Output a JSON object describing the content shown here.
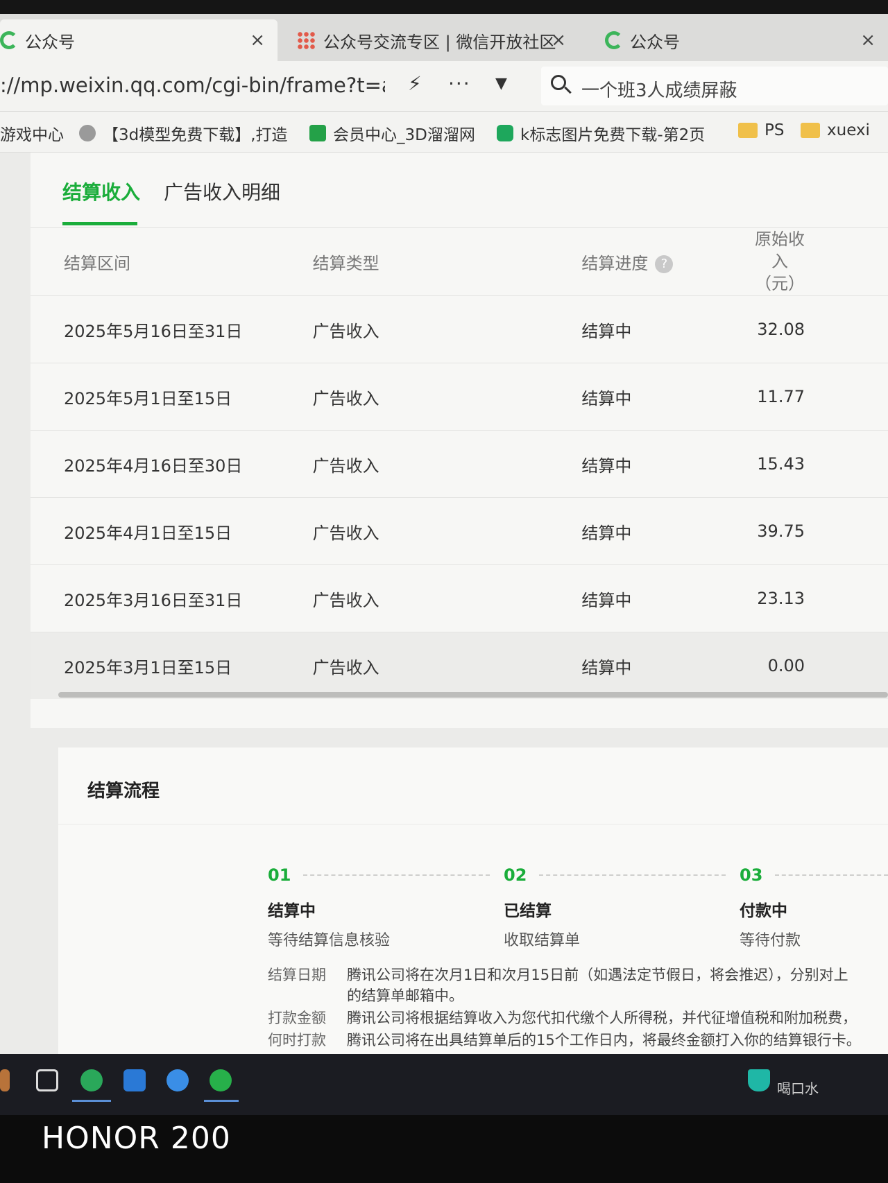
{
  "browser": {
    "tabs": [
      {
        "title": "公众号",
        "close": "×"
      },
      {
        "title": "公众号交流专区 | 微信开放社区",
        "close": "×"
      },
      {
        "title": "公众号",
        "close": "×"
      }
    ],
    "url": "://mp.weixin.qq.com/cgi-bin/frame?t=ad_system",
    "search_query": "一个班3人成绩屏蔽",
    "bookmarks": [
      "游戏中心",
      "【3d模型免费下载】,打造",
      "会员中心_3D溜溜网",
      "k标志图片免费下载-第2页",
      "PS",
      "xuexi"
    ]
  },
  "page": {
    "tabs": [
      {
        "label": "结算收入",
        "active": true
      },
      {
        "label": "广告收入明细",
        "active": false
      }
    ],
    "table": {
      "headers": [
        "结算区间",
        "结算类型",
        "结算进度",
        "原始收入",
        "（元）"
      ],
      "rows": [
        {
          "period": "2025年5月16日至31日",
          "type": "广告收入",
          "status": "结算中",
          "amount": "32.08"
        },
        {
          "period": "2025年5月1日至15日",
          "type": "广告收入",
          "status": "结算中",
          "amount": "11.77"
        },
        {
          "period": "2025年4月16日至30日",
          "type": "广告收入",
          "status": "结算中",
          "amount": "15.43"
        },
        {
          "period": "2025年4月1日至15日",
          "type": "广告收入",
          "status": "结算中",
          "amount": "39.75"
        },
        {
          "period": "2025年3月16日至31日",
          "type": "广告收入",
          "status": "结算中",
          "amount": "23.13"
        },
        {
          "period": "2025年3月1日至15日",
          "type": "广告收入",
          "status": "结算中",
          "amount": "0.00"
        }
      ]
    },
    "flow": {
      "title": "结算流程",
      "steps": [
        {
          "num": "01",
          "name": "结算中",
          "desc": "等待结算信息核验"
        },
        {
          "num": "02",
          "name": "已结算",
          "desc": "收取结算单"
        },
        {
          "num": "03",
          "name": "付款中",
          "desc": "等待付款"
        }
      ],
      "info": [
        {
          "key": "结算日期",
          "value": "腾讯公司将在次月1日和次月15日前（如遇法定节假日，将会推迟），分别对上"
        },
        {
          "key": "",
          "value": "的结算单邮箱中。"
        },
        {
          "key": "打款金额",
          "value": "腾讯公司将根据结算收入为您代扣代缴个人所得税，并代征增值税和附加税费，"
        },
        {
          "key": "何时打款",
          "value": "腾讯公司将在出具结算单后的15个工作日内，将最终金额打入你的结算银行卡。"
        }
      ]
    }
  },
  "taskbar": {
    "tray_text": "喝口水"
  },
  "watermark": "HONOR 200",
  "colors": {
    "accent": "#1aad3a",
    "taskbar": "#1b1c22"
  }
}
